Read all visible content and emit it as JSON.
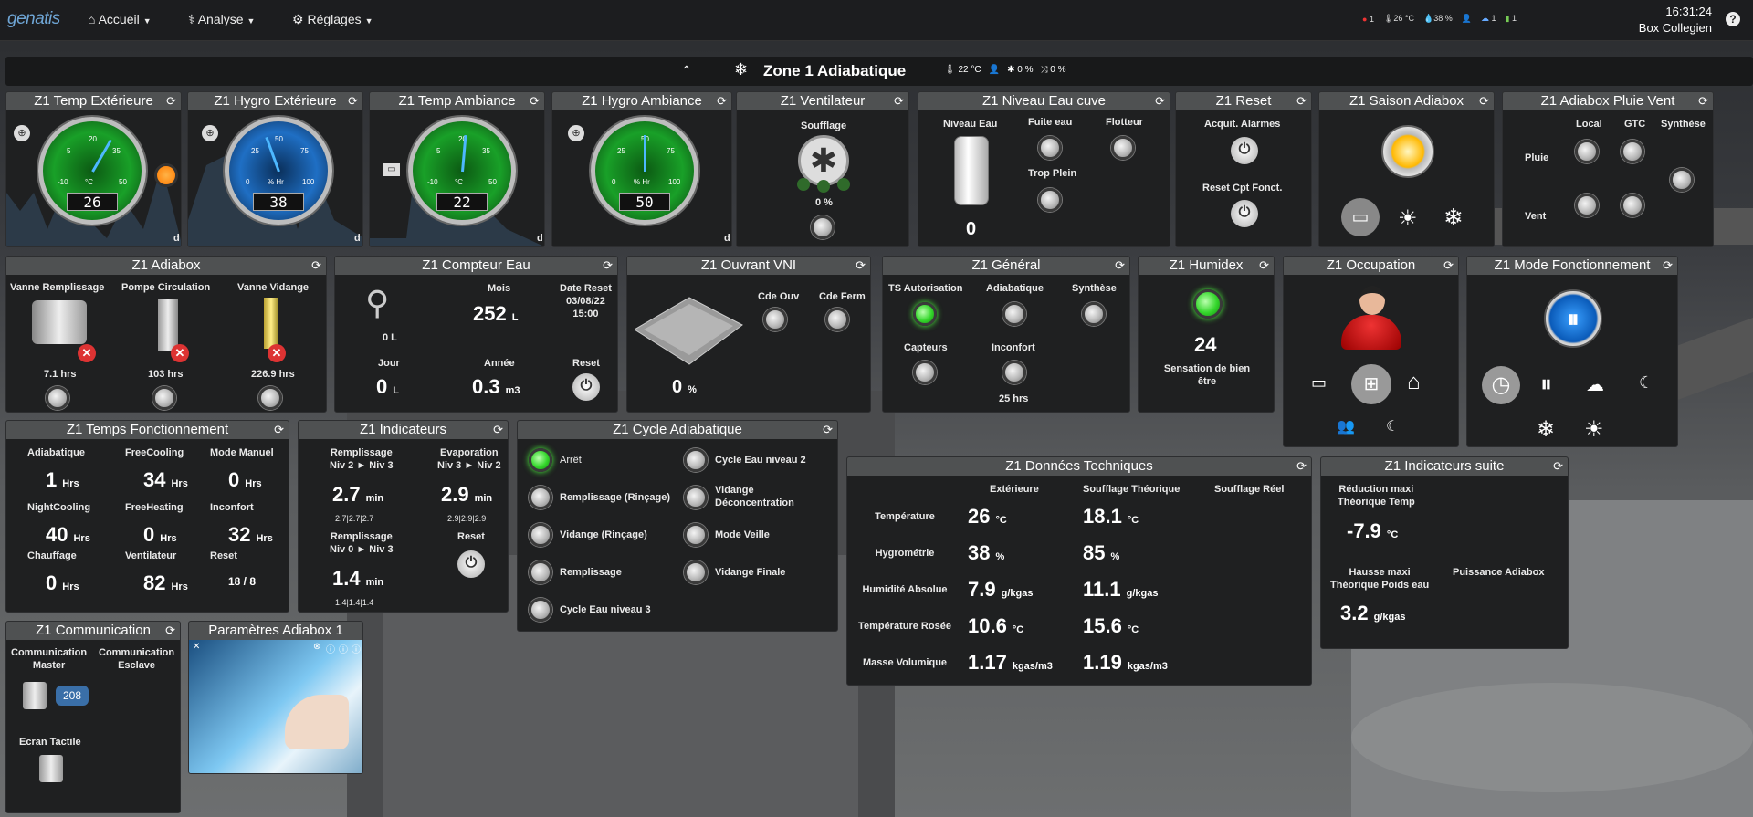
{
  "nav": {
    "logo": "genatis",
    "accueil": "Accueil",
    "analyse": "Analyse",
    "reglages": "Réglages"
  },
  "status": {
    "alarms": "1",
    "temp": "26 °C",
    "hygro": "38 %",
    "users": "1",
    "net": "1"
  },
  "clock": {
    "time": "16:31:24",
    "box": "Box Collegien"
  },
  "zone": {
    "title": "Zone 1 Adiabatique",
    "temp": "22 °C",
    "fan": "0 %",
    "mix": "0 %"
  },
  "p1": {
    "title": "Z1 Temp Extérieure",
    "value": "26",
    "unit": "°C",
    "ticks": [
      "5",
      "20",
      "35",
      "-10",
      "50"
    ],
    "axis": "d"
  },
  "p2": {
    "title": "Z1 Hygro Extérieure",
    "value": "38",
    "unit": "% Hr",
    "ticks": [
      "25",
      "50",
      "75",
      "0",
      "100"
    ],
    "axis": "d"
  },
  "p3": {
    "title": "Z1 Temp Ambiance",
    "value": "22",
    "unit": "°C",
    "ticks": [
      "5",
      "20",
      "35",
      "-10",
      "50"
    ],
    "axis": "d"
  },
  "p4": {
    "title": "Z1 Hygro Ambiance",
    "value": "50",
    "unit": "% Hr",
    "ticks": [
      "25",
      "50",
      "75",
      "0",
      "100"
    ],
    "axis": "d"
  },
  "p5": {
    "title": "Z1 Ventilateur",
    "soufflage": "Soufflage",
    "value": "0 %"
  },
  "p6": {
    "title": "Z1 Niveau Eau cuve",
    "niveau": "Niveau Eau",
    "fuite": "Fuite eau",
    "flotteur": "Flotteur",
    "trop": "Trop Plein",
    "value": "0"
  },
  "p7": {
    "title": "Z1 Reset",
    "acquit": "Acquit. Alarmes",
    "reset": "Reset Cpt Fonct."
  },
  "p8": {
    "title": "Z1 Saison Adiabox"
  },
  "p9": {
    "title": "Z1 Adiabox Pluie Vent",
    "local": "Local",
    "gtc": "GTC",
    "synth": "Synthèse",
    "pluie": "Pluie",
    "vent": "Vent"
  },
  "p10": {
    "title": "Z1 Adiabox",
    "vr": "Vanne Remplissage",
    "pc": "Pompe Circulation",
    "vv": "Vanne Vidange",
    "h1": "7.1 hrs",
    "h2": "103 hrs",
    "h3": "226.9 hrs"
  },
  "p11": {
    "title": "Z1 Compteur Eau",
    "v0": "0 L",
    "mois": "Mois",
    "mois_v": "252",
    "L": "L",
    "date": "Date Reset",
    "date_v": "03/08/22",
    "time_v": "15:00",
    "jour": "Jour",
    "jour_v": "0",
    "annee": "Année",
    "annee_v": "0.3",
    "m3": "m3",
    "reset": "Reset"
  },
  "p12": {
    "title": "Z1 Ouvrant VNI",
    "cdeouv": "Cde Ouv",
    "cdeferm": "Cde Ferm",
    "value": "0",
    "pct": "%"
  },
  "p13": {
    "title": "Z1 Général",
    "ts": "TS Autorisation",
    "adia": "Adiabatique",
    "synth": "Synthèse",
    "capt": "Capteurs",
    "inc": "Inconfort",
    "hrs": "25 hrs"
  },
  "p14": {
    "title": "Z1 Humidex",
    "value": "24",
    "label": "Sensation de bien être"
  },
  "p15": {
    "title": "Z1 Occupation"
  },
  "p16": {
    "title": "Z1 Mode Fonctionnement"
  },
  "p17": {
    "title": "Z1 Temps Fonctionnement",
    "cells": [
      [
        "Adiabatique",
        "1",
        "Hrs"
      ],
      [
        "FreeCooling",
        "34",
        "Hrs"
      ],
      [
        "Mode Manuel",
        "0",
        "Hrs"
      ],
      [
        "NightCooling",
        "40",
        "Hrs"
      ],
      [
        "FreeHeating",
        "0",
        "Hrs"
      ],
      [
        "Inconfort",
        "32",
        "Hrs"
      ],
      [
        "Chauffage",
        "0",
        "Hrs"
      ],
      [
        "Ventilateur",
        "82",
        "Hrs"
      ],
      [
        "Reset",
        "18 / 8",
        ""
      ]
    ]
  },
  "p18": {
    "title": "Z1 Indicateurs",
    "r1a": "Remplissage",
    "r1b": "Niv 2 ► Niv 3",
    "v1": "2.7",
    "min": "min",
    "s1": "2.7|2.7|2.7",
    "e1a": "Evaporation",
    "e1b": "Niv 3 ► Niv 2",
    "v2": "2.9",
    "s2": "2.9|2.9|2.9",
    "r2a": "Remplissage",
    "r2b": "Niv 0 ► Niv 3",
    "v3": "1.4",
    "s3": "1.4|1.4|1.4",
    "reset": "Reset"
  },
  "p19": {
    "title": "Z1 Cycle Adiabatique",
    "left": [
      "Arrêt",
      "Remplissage (Rinçage)",
      "Vidange (Rinçage)",
      "Remplissage",
      "Cycle Eau niveau 3"
    ],
    "right": [
      "Cycle Eau niveau 2",
      "Vidange Déconcentration",
      "Mode Veille",
      "Vidange Finale"
    ]
  },
  "p20": {
    "title": "Z1 Données Techniques",
    "cols": [
      "Extérieure",
      "Soufflage Théorique",
      "Soufflage Réel"
    ],
    "rows": [
      [
        "Température",
        "26",
        "°C",
        "18.1",
        "°C"
      ],
      [
        "Hygrométrie",
        "38",
        "%",
        "85",
        "%"
      ],
      [
        "Humidité Absolue",
        "7.9",
        "g/kgas",
        "11.1",
        "g/kgas"
      ],
      [
        "Température Rosée",
        "10.6",
        "°C",
        "15.6",
        "°C"
      ],
      [
        "Masse Volumique",
        "1.17",
        "kgas/m3",
        "1.19",
        "kgas/m3"
      ]
    ]
  },
  "p21": {
    "title": "Z1 Indicateurs suite",
    "red1": "Réduction maxi",
    "red2": "Théorique Temp",
    "v1": "-7.9",
    "u1": "°C",
    "h1": "Hausse maxi",
    "h2": "Théorique Poids eau",
    "pa": "Puissance Adiabox",
    "v2": "3.2",
    "u2": "g/kgas"
  },
  "p22": {
    "title": "Z1 Communication",
    "master1": "Communication",
    "master2": "Master",
    "slave1": "Communication",
    "slave2": "Esclave",
    "badge": "208",
    "ecran": "Ecran Tactile"
  },
  "p23": {
    "title": "Paramètres Adiabox 1"
  }
}
